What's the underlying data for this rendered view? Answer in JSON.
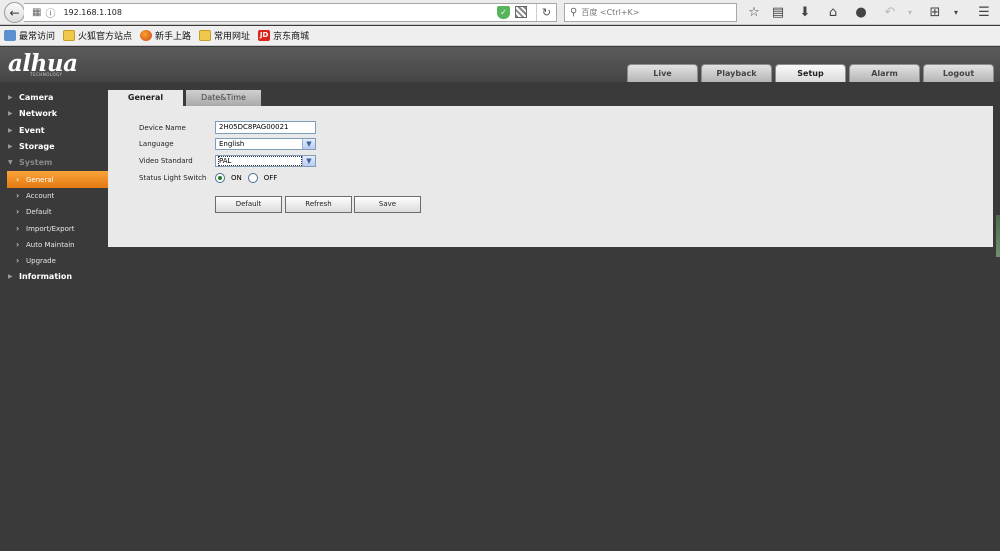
{
  "browser": {
    "url": "192.168.1.108",
    "search_placeholder": "百度 <Ctrl+K>",
    "bookmarks": [
      "最常访问",
      "火狐官方站点",
      "新手上路",
      "常用网址",
      "京东商城"
    ]
  },
  "header": {
    "logo": "alhua",
    "logo_subtitle": "TECHNOLOGY",
    "tabs": [
      "Live",
      "Playback",
      "Setup",
      "Alarm",
      "Logout"
    ],
    "active_tab": "Setup"
  },
  "sidebar": {
    "categories": [
      "Camera",
      "Network",
      "Event",
      "Storage",
      "System",
      "Information"
    ],
    "system_items": [
      "General",
      "Account",
      "Default",
      "Import/Export",
      "Auto Maintain",
      "Upgrade"
    ],
    "active_item": "General"
  },
  "content": {
    "tabs": [
      "General",
      "Date&Time"
    ],
    "active_tab": "General",
    "form": {
      "device_name_label": "Device Name",
      "device_name_value": "2H05DC8PAG00021",
      "language_label": "Language",
      "language_value": "English",
      "video_standard_label": "Video Standard",
      "video_standard_value": "PAL",
      "status_light_label": "Status Light Switch",
      "status_on": "ON",
      "status_off": "OFF",
      "status_selected": "ON"
    },
    "buttons": [
      "Default",
      "Refresh",
      "Save"
    ]
  },
  "colors": {
    "accent": "#f08a1c",
    "background": "#3a3a3a",
    "panel": "#e9e9e9"
  }
}
